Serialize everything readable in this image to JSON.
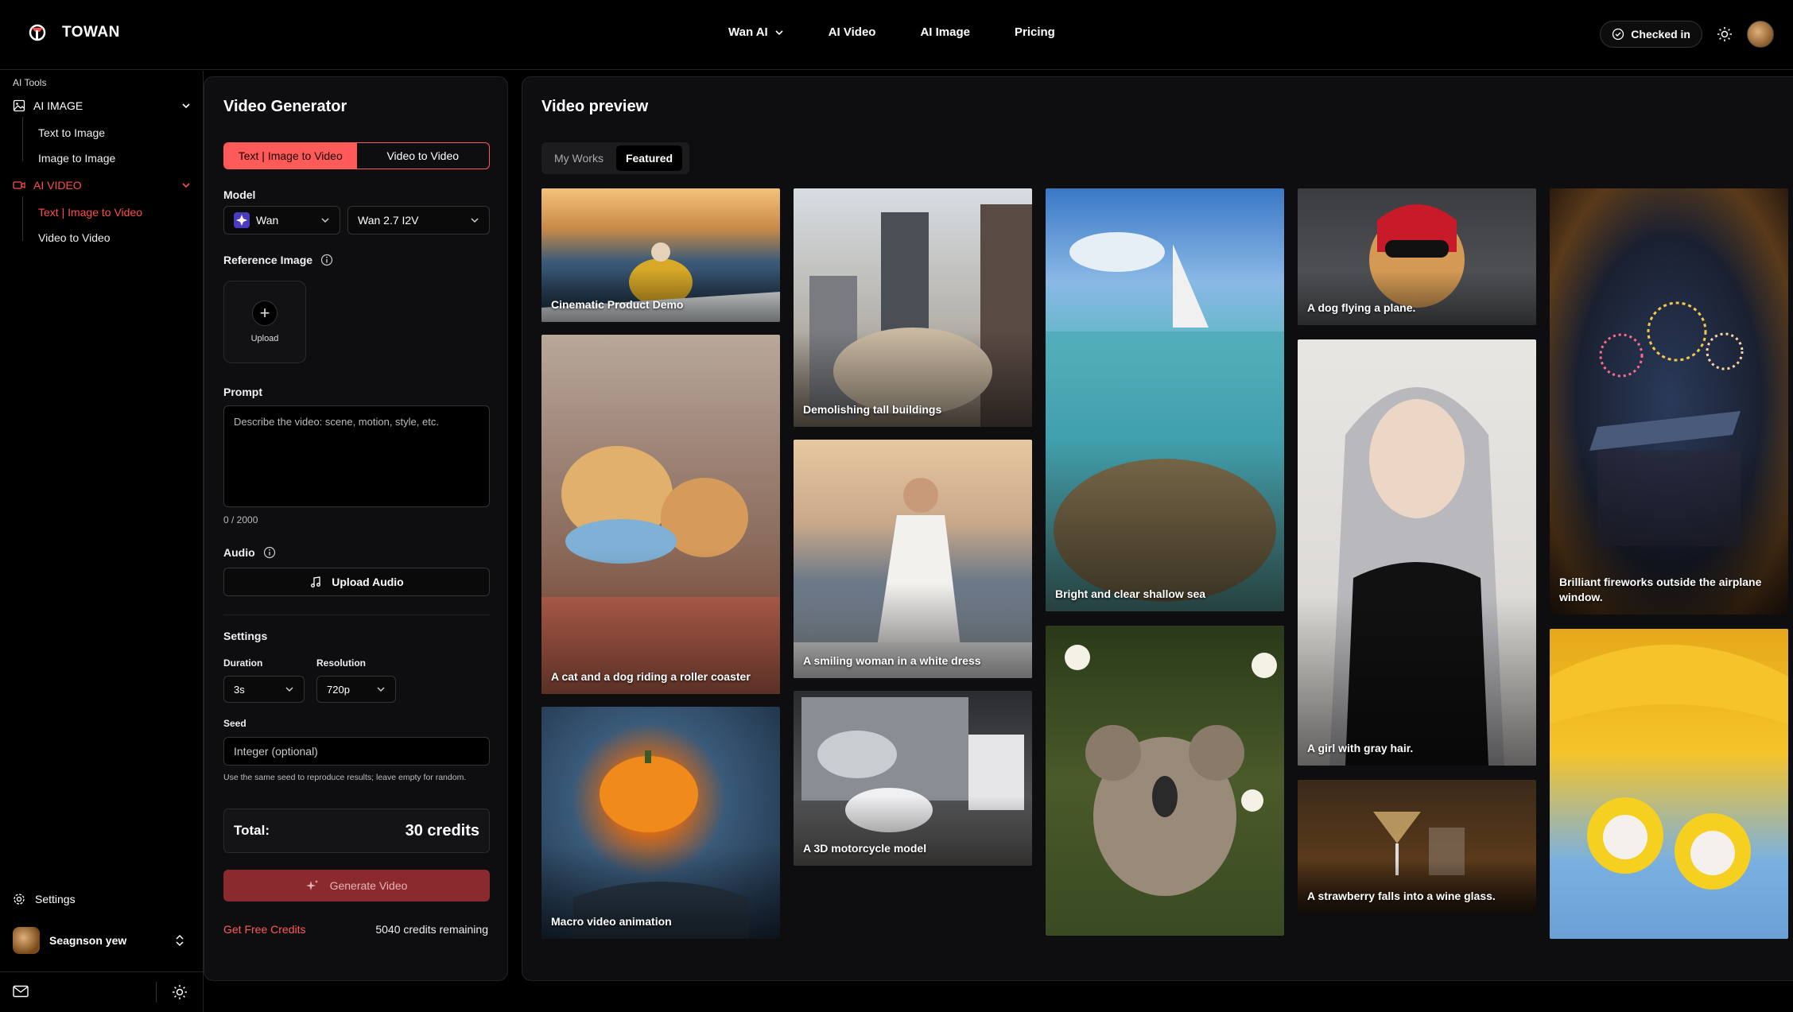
{
  "topbar": {
    "brand": "TOWAN",
    "nav": [
      {
        "label": "Wan AI",
        "has_dropdown": true
      },
      {
        "label": "AI Video",
        "has_dropdown": false
      },
      {
        "label": "AI Image",
        "has_dropdown": false
      },
      {
        "label": "Pricing",
        "has_dropdown": false
      }
    ],
    "checked_in": "Checked in"
  },
  "sidebar": {
    "heading": "AI Tools",
    "groups": [
      {
        "label": "AI IMAGE",
        "icon": "image-icon",
        "items": [
          "Text to Image",
          "Image to Image"
        ]
      },
      {
        "label": "AI VIDEO",
        "icon": "video-icon",
        "items": [
          "Text | Image to Video",
          "Video to Video"
        ]
      }
    ],
    "settings": "Settings",
    "user": "Seagnson yew"
  },
  "generator": {
    "title": "Video Generator",
    "modes": [
      "Text | Image to Video",
      "Video to Video"
    ],
    "model_label": "Model",
    "model": "Wan",
    "model_version": "Wan 2.7 I2V",
    "reference_label": "Reference Image",
    "upload": "Upload",
    "prompt_label": "Prompt",
    "prompt_placeholder": "Describe the video: scene, motion, style, etc.",
    "prompt_counter": "0 / 2000",
    "audio_label": "Audio",
    "upload_audio": "Upload Audio",
    "settings_label": "Settings",
    "duration_label": "Duration",
    "duration": "3s",
    "resolution_label": "Resolution",
    "resolution": "720p",
    "seed_label": "Seed",
    "seed_placeholder": "Integer (optional)",
    "seed_hint": "Use the same seed to reproduce results; leave empty for random.",
    "total_label": "Total:",
    "total_value": "30 credits",
    "generate": "Generate Video",
    "free_credits": "Get Free Credits",
    "credits_remaining": "5040 credits remaining"
  },
  "preview": {
    "title": "Video preview",
    "tabs": [
      "My Works",
      "Featured"
    ],
    "captions": [
      "Cinematic Product Demo",
      "A cat and a dog riding a roller coaster",
      "Macro video animation",
      "Demolishing tall buildings",
      "A smiling woman in a white dress",
      "A 3D motorcycle model",
      "Bright and clear shallow sea",
      "A dog flying a plane.",
      "A girl with gray hair.",
      "A strawberry falls into a wine glass.",
      "Brilliant fireworks outside the airplane window."
    ]
  },
  "colors": {
    "accent": "#ff5a5a",
    "generate_bg": "#8b2a2e",
    "panel_bg": "#0e0e10"
  }
}
